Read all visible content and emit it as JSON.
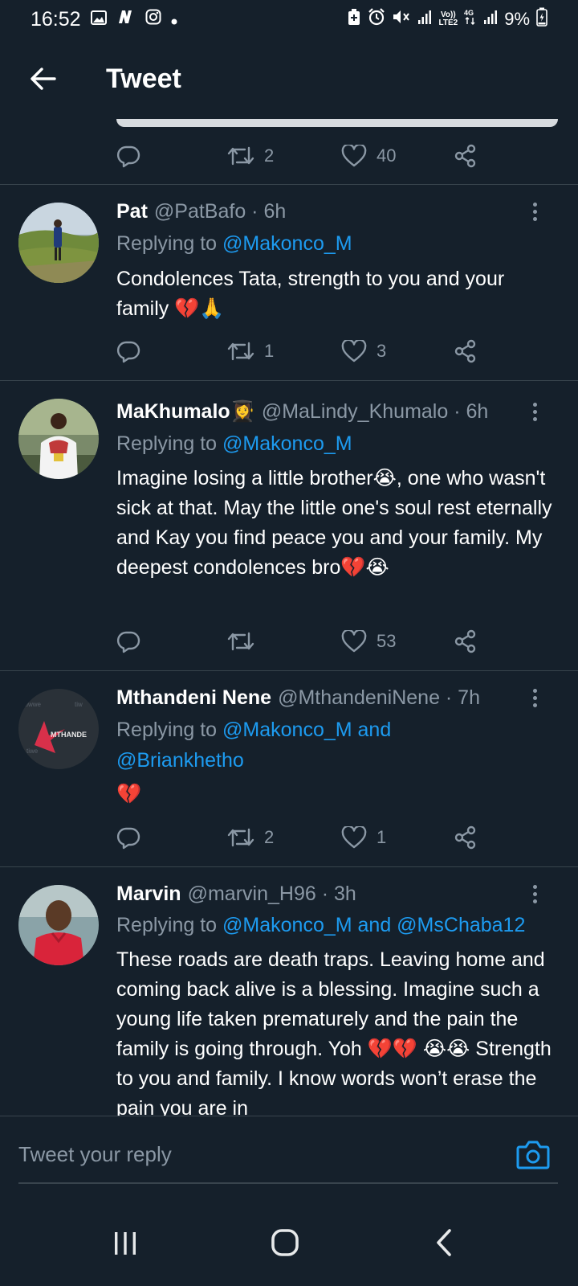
{
  "status_bar": {
    "time": "16:52",
    "network_label": "LTE2",
    "battery": "9%"
  },
  "header": {
    "title": "Tweet"
  },
  "top_actions": {
    "retweets": "2",
    "likes": "40"
  },
  "tweets": [
    {
      "name": "Pat",
      "handle": "@PatBafo · 6h",
      "replying_prefix": "Replying to ",
      "replying_to": "@Makonco_M",
      "text": "Condolences Tata, strength to you and your family 💔🙏",
      "replies": "",
      "retweets": "1",
      "likes": "3"
    },
    {
      "name": "MaKhumalo👩‍🎓",
      "handle": "@MaLindy_Khumalo · 6h",
      "replying_prefix": "Replying to ",
      "replying_to": "@Makonco_M",
      "text": "Imagine losing a little brother😭, one who wasn't sick at that. May the little one's soul rest eternally and Kay you find peace you and your family. My deepest condolences bro💔😭",
      "replies": "",
      "retweets": "",
      "likes": "53"
    },
    {
      "name": "Mthandeni Nene",
      "handle": "@MthandeniNene · 7h",
      "replying_prefix": "Replying to ",
      "replying_to": "@Makonco_M and @Briankhetho",
      "text": "💔",
      "replies": "",
      "retweets": "2",
      "likes": "1",
      "avatar_text": "MTHANDE"
    },
    {
      "name": "Marvin",
      "handle": "@marvin_H96 · 3h",
      "replying_prefix": "Replying to ",
      "replying_to": "@Makonco_M and @MsChaba12",
      "text": "These roads are death traps. Leaving home and coming back alive is a blessing. Imagine such a young life taken prematurely and the pain the family is going through. Yoh 💔💔 😭😭 Strength to you and family. I know words won’t erase the pain you are in"
    }
  ],
  "reply_bar": {
    "placeholder": "Tweet your reply"
  },
  "icons": {
    "back": "arrow-left-icon",
    "reply": "comment-bubble-icon",
    "retweet": "retweet-icon",
    "like": "heart-icon",
    "share": "share-icon",
    "camera": "camera-icon"
  },
  "colors": {
    "background": "#15202b",
    "accent": "#1d9bf0",
    "muted": "#8b98a5",
    "divider": "#38444d"
  }
}
